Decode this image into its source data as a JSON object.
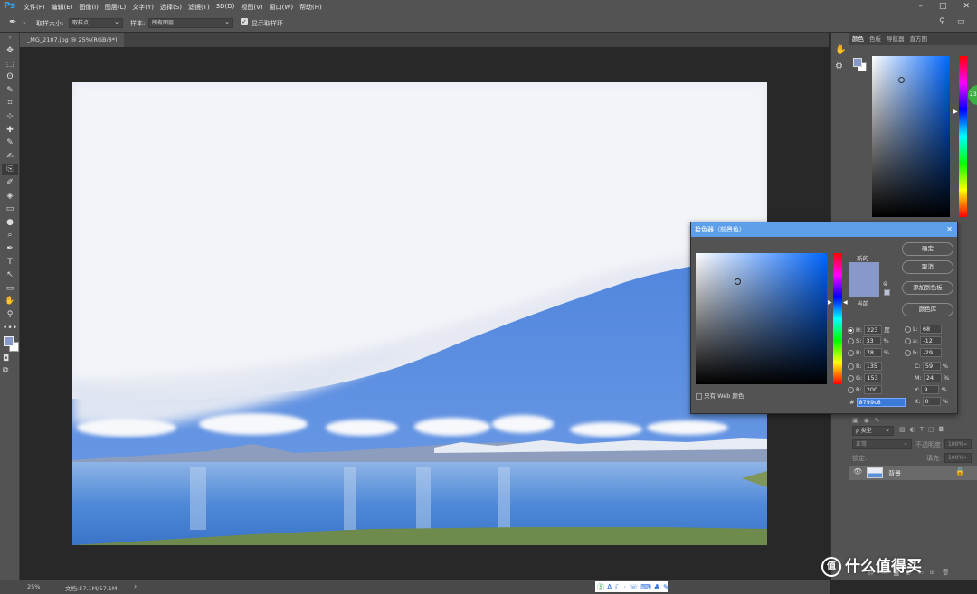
{
  "app": {
    "logo": "Ps"
  },
  "menu": [
    "文件(F)",
    "编辑(E)",
    "图像(I)",
    "图层(L)",
    "文字(Y)",
    "选择(S)",
    "滤镜(T)",
    "3D(D)",
    "视图(V)",
    "窗口(W)",
    "帮助(H)"
  ],
  "window_controls": {
    "min": "–",
    "max": "□",
    "close": "✕"
  },
  "options": {
    "sample_size_label": "取样大小:",
    "sample_size_value": "取样点",
    "sample_label": "样本:",
    "sample_value": "所有图层",
    "show_ring_label": "显示取样环"
  },
  "tools": [
    "✥",
    "⬚",
    "ʘ",
    "✎",
    "⌗",
    "⊹",
    "✚",
    "✎",
    "✍",
    "⎘",
    "✐",
    "◈",
    "▭",
    "●",
    "⌕",
    "✒",
    "T",
    "↖",
    "▭",
    "✋",
    "⚲",
    "•••"
  ],
  "document": {
    "tab_title": "_MG_2107.jpg @ 25%(RGB/8*)",
    "tab_close": "×"
  },
  "status": {
    "zoom": "25%",
    "doc_info": "文档:57.1M/57.1M",
    "arrow": "›"
  },
  "color_panel": {
    "tabs": [
      "颜色",
      "色板",
      "导航器",
      "直方图"
    ],
    "badge": "23"
  },
  "picker": {
    "title": "拾色器（前景色）",
    "close": "✕",
    "new_label": "新的",
    "current_label": "当前",
    "ok": "确定",
    "cancel": "取消",
    "add_swatch": "添加到色板",
    "color_lib": "颜色库",
    "web_only": "只有 Web 颜色",
    "H": {
      "label": "H:",
      "value": "223",
      "unit": "度"
    },
    "S": {
      "label": "S:",
      "value": "33",
      "unit": "%"
    },
    "Bv": {
      "label": "B:",
      "value": "78",
      "unit": "%"
    },
    "R": {
      "label": "R:",
      "value": "135"
    },
    "G": {
      "label": "G:",
      "value": "153"
    },
    "B": {
      "label": "B:",
      "value": "200"
    },
    "L": {
      "label": "L:",
      "value": "68"
    },
    "a": {
      "label": "a:",
      "value": "-12"
    },
    "b": {
      "label": "b:",
      "value": "-29"
    },
    "C": {
      "label": "C:",
      "value": "59",
      "unit": "%"
    },
    "M": {
      "label": "M:",
      "value": "24",
      "unit": "%"
    },
    "Y": {
      "label": "Y:",
      "value": "9",
      "unit": "%"
    },
    "K": {
      "label": "K:",
      "value": "0",
      "unit": "%"
    },
    "hex_label": "#",
    "hex": "8799c8",
    "new_color": "#8799c8",
    "hue_color": "#0066ff"
  },
  "layers": {
    "filter_label": "ρ 类型",
    "blend": "正常",
    "opacity_label": "不透明度:",
    "opacity_value": "100%",
    "lock_label": "锁定:",
    "fill_label": "填充:",
    "fill_value": "100%",
    "layer_name": "背景"
  },
  "watermark": "什么值得买"
}
